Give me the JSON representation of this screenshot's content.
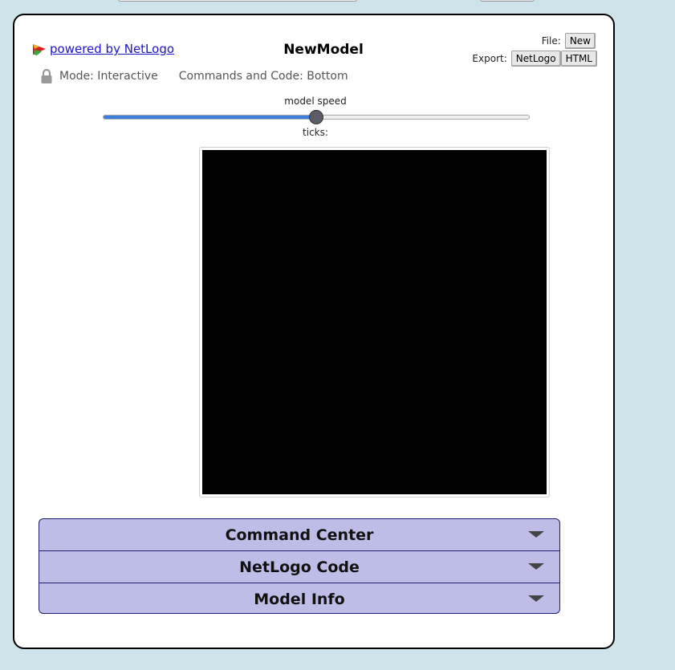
{
  "powered_by": "powered by NetLogo",
  "model_title": "NewModel",
  "file": {
    "label": "File:",
    "new_label": "New"
  },
  "export": {
    "label": "Export:",
    "netlogo_label": "NetLogo",
    "html_label": "HTML"
  },
  "mode": {
    "mode_label": "Mode: Interactive",
    "commands_label": "Commands and Code: Bottom",
    "icon": "lock-icon"
  },
  "speed": {
    "label": "model speed",
    "value_fraction": 0.5
  },
  "ticks_label": "ticks:",
  "view": {
    "background": "#000000"
  },
  "drawers": [
    {
      "label": "Command Center"
    },
    {
      "label": "NetLogo Code"
    },
    {
      "label": "Model Info"
    }
  ],
  "colors": {
    "page_bg": "#cfe4ea",
    "drawer_bg": "#bdbde8",
    "drawer_border": "#1d1d70",
    "slider_fill": "#3b7ddd",
    "link": "#1a16c8"
  }
}
